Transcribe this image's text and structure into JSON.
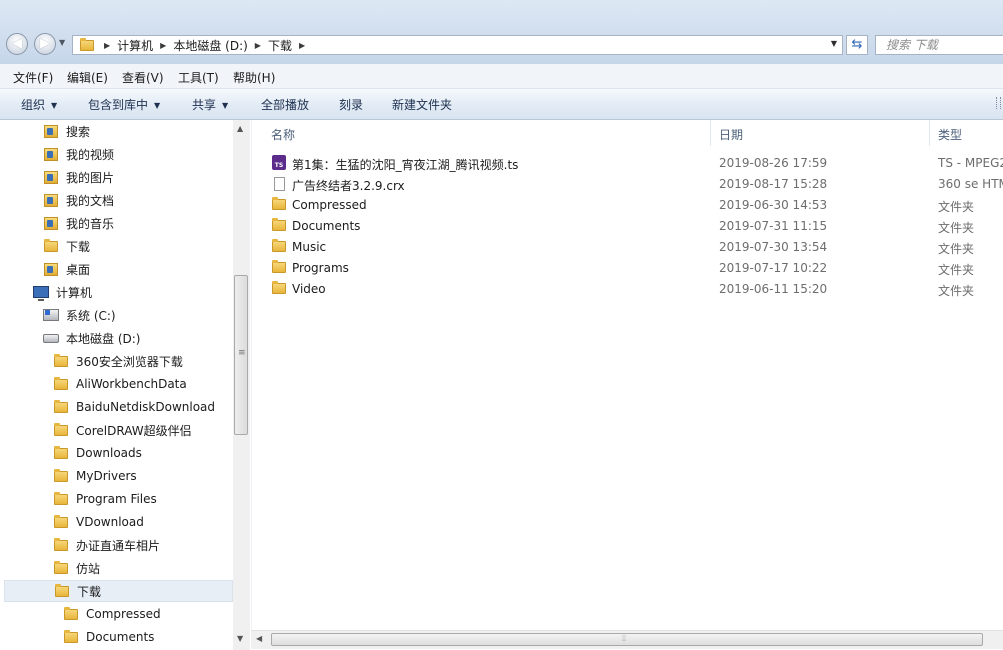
{
  "address": {
    "crumbs": [
      "计算机",
      "本地磁盘 (D:)",
      "下载"
    ],
    "search_placeholder": "搜索 下载"
  },
  "menu": [
    "文件(F)",
    "编辑(E)",
    "查看(V)",
    "工具(T)",
    "帮助(H)"
  ],
  "commands": {
    "organize": "组织",
    "include_in_library": "包含到库中",
    "share": "共享",
    "play_all": "全部播放",
    "burn": "刻录",
    "new_folder": "新建文件夹"
  },
  "nav": [
    {
      "label": "搜索",
      "icon": "search-folder-icon"
    },
    {
      "label": "我的视频",
      "icon": "videos-library-icon"
    },
    {
      "label": "我的图片",
      "icon": "pictures-library-icon"
    },
    {
      "label": "我的文档",
      "icon": "documents-library-icon"
    },
    {
      "label": "我的音乐",
      "icon": "music-library-icon"
    },
    {
      "label": "下载",
      "icon": "downloads-folder-icon"
    },
    {
      "label": "桌面",
      "icon": "desktop-folder-icon"
    },
    {
      "label": "计算机",
      "icon": "computer-icon"
    },
    {
      "label": "系统 (C:)",
      "icon": "system-drive-icon"
    },
    {
      "label": "本地磁盘 (D:)",
      "icon": "drive-icon"
    },
    {
      "label": "360安全浏览器下载",
      "icon": "folder-icon"
    },
    {
      "label": "AliWorkbenchData",
      "icon": "folder-icon"
    },
    {
      "label": "BaiduNetdiskDownload",
      "icon": "folder-icon"
    },
    {
      "label": "CorelDRAW超级伴侣",
      "icon": "folder-icon"
    },
    {
      "label": "Downloads",
      "icon": "folder-icon"
    },
    {
      "label": "MyDrivers",
      "icon": "folder-icon"
    },
    {
      "label": "Program Files",
      "icon": "folder-icon"
    },
    {
      "label": "VDownload",
      "icon": "folder-icon"
    },
    {
      "label": "办证直通车相片",
      "icon": "folder-icon"
    },
    {
      "label": "仿站",
      "icon": "folder-icon"
    },
    {
      "label": "下载",
      "icon": "folder-icon",
      "selected": true
    },
    {
      "label": "Compressed",
      "icon": "folder-icon"
    },
    {
      "label": "Documents",
      "icon": "folder-icon"
    }
  ],
  "columns": {
    "name": "名称",
    "date": "日期",
    "type": "类型"
  },
  "files": [
    {
      "name": "第1集：生猛的沈阳_宵夜江湖_腾讯视频.ts",
      "date": "2019-08-26 17:59",
      "type": "TS - MPEG2",
      "icon": "ts-video-icon"
    },
    {
      "name": "广告终结者3.2.9.crx",
      "date": "2019-08-17 15:28",
      "type": "360 se HTM",
      "icon": "file-icon"
    },
    {
      "name": "Compressed",
      "date": "2019-06-30 14:53",
      "type": "文件夹",
      "icon": "folder-icon"
    },
    {
      "name": "Documents",
      "date": "2019-07-31 11:15",
      "type": "文件夹",
      "icon": "folder-icon"
    },
    {
      "name": "Music",
      "date": "2019-07-30 13:54",
      "type": "文件夹",
      "icon": "folder-icon"
    },
    {
      "name": "Programs",
      "date": "2019-07-17 10:22",
      "type": "文件夹",
      "icon": "folder-icon"
    },
    {
      "name": "Video",
      "date": "2019-06-11 15:20",
      "type": "文件夹",
      "icon": "folder-icon"
    }
  ]
}
